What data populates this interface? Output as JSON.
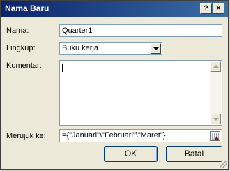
{
  "window": {
    "title": "Nama Baru"
  },
  "titlebar": {
    "help_glyph": "?",
    "close_glyph": "×"
  },
  "form": {
    "name_label": "Nama:",
    "name_value": "Quarter1",
    "scope_label": "Lingkup:",
    "scope_value": "Buku kerja",
    "comment_label": "Komentar:",
    "comment_value": "",
    "refers_label": "Merujuk ke:",
    "refers_value": "={\"Januari\"\\\"Februari\"\\\"Maret\"}"
  },
  "buttons": {
    "ok": "OK",
    "cancel": "Batal"
  },
  "colors": {
    "titlebar_start": "#0a246a",
    "titlebar_end": "#3a6ea5",
    "face": "#ece9d8",
    "field_border": "#7f9db9"
  }
}
